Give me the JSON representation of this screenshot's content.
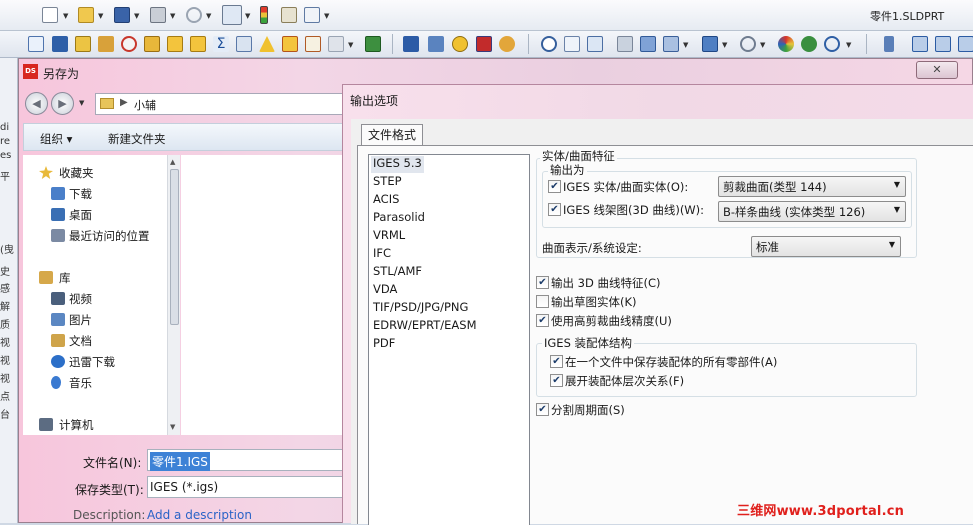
{
  "app": {
    "document_title": "零件1.SLDPRT"
  },
  "underlying_app_fragments": [
    "di",
    "re",
    "es",
    "平",
    "(曳",
    "史",
    "感",
    "解",
    "质",
    "视",
    "视",
    "视",
    "点",
    "台"
  ],
  "save_as": {
    "title": "另存为",
    "logo_text": "DS",
    "close_label": "✕",
    "path": "小辅",
    "toolbar": {
      "organize": "组织 ▾",
      "new_folder": "新建文件夹"
    },
    "nav_items": [
      {
        "label": "收藏夹",
        "icon": "star-icon",
        "color": "#e8b93a"
      },
      {
        "label": "下载",
        "icon": "download-folder-icon",
        "color": "#4a7fc9"
      },
      {
        "label": "桌面",
        "icon": "desktop-icon",
        "color": "#3a6fb4"
      },
      {
        "label": "最近访问的位置",
        "icon": "recent-places-icon",
        "color": "#7b8aa3"
      },
      {
        "label": "库",
        "icon": "library-icon",
        "color": "#d6a84a"
      },
      {
        "label": "视频",
        "icon": "video-icon",
        "color": "#4a5f7c"
      },
      {
        "label": "图片",
        "icon": "pictures-icon",
        "color": "#5b87c2"
      },
      {
        "label": "文档",
        "icon": "documents-icon",
        "color": "#cfa44a"
      },
      {
        "label": "迅雷下载",
        "icon": "thunder-icon",
        "color": "#2c6fc8"
      },
      {
        "label": "音乐",
        "icon": "music-icon",
        "color": "#3a7ad1"
      },
      {
        "label": "计算机",
        "icon": "computer-icon",
        "color": "#5c6c82"
      }
    ],
    "filename_label": "文件名(N):",
    "filename_value": "零件1.IGS",
    "filetype_label": "保存类型(T):",
    "filetype_value": "IGES (*.igs)",
    "description_label": "Description:",
    "description_link": "Add a description"
  },
  "export_options": {
    "title": "输出选项",
    "tab": "文件格式",
    "formats": [
      "IGES 5.3",
      "STEP",
      "ACIS",
      "Parasolid",
      "VRML",
      "IFC",
      "STL/AMF",
      "VDA",
      "TIF/PSD/JPG/PNG",
      "EDRW/EPRT/EASM",
      "PDF"
    ],
    "selected_format_index": 0,
    "solid_surface_group": "实体/曲面特征",
    "output_as_group": "输出为",
    "iges_solid_label": "IGES 实体/曲面实体(O):",
    "iges_solid_checked": true,
    "iges_solid_value": "剪裁曲面(类型 144)",
    "iges_wire_label": "IGES 线架图(3D 曲线)(W):",
    "iges_wire_checked": true,
    "iges_wire_value": "B-样条曲线 (实体类型 126)",
    "surface_rep_label": "曲面表示/系统设定:",
    "surface_rep_value": "标准",
    "options": [
      {
        "label": "输出 3D 曲线特征(C)",
        "checked": true
      },
      {
        "label": "输出草图实体(K)",
        "checked": false
      },
      {
        "label": "使用高剪裁曲线精度(U)",
        "checked": true
      }
    ],
    "assembly_group": "IGES 装配体结构",
    "assembly_options": [
      {
        "label": "在一个文件中保存装配体的所有零部件(A)",
        "checked": true
      },
      {
        "label": "展开装配体层次关系(F)",
        "checked": true
      }
    ],
    "split_periodic_label": "分割周期面(S)",
    "split_periodic_checked": true
  },
  "watermark": "三维网www.3dportal.cn"
}
